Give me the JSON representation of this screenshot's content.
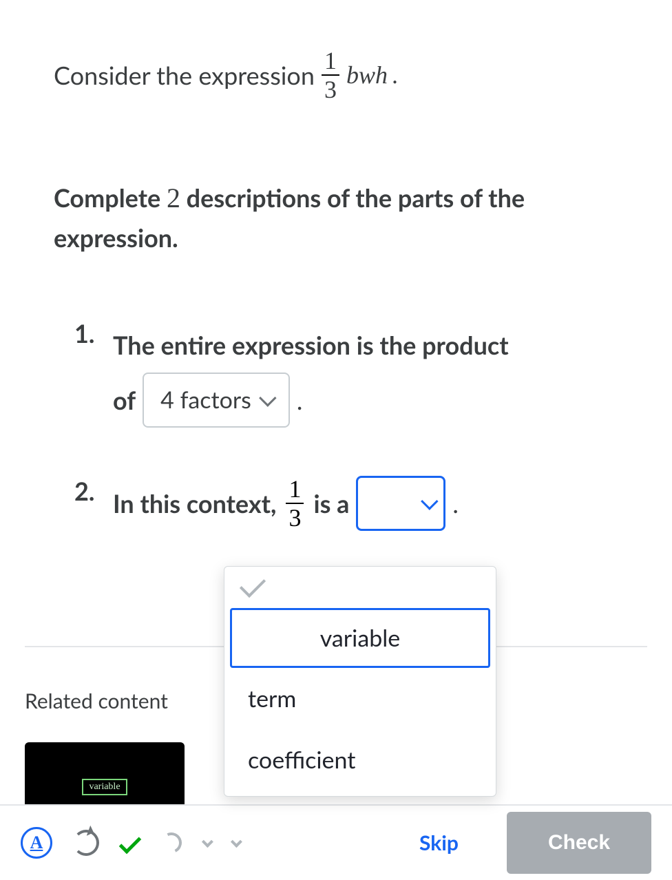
{
  "prompt": {
    "prefix": "Consider the expression",
    "frac_num": "1",
    "frac_den": "3",
    "vars": "bwh",
    "suffix": "."
  },
  "instruction": {
    "pre": "Complete ",
    "count": "2",
    "post": " descriptions of the parts of the expression."
  },
  "q1": {
    "num": "1.",
    "text_a": "The entire expression is the product",
    "text_b": "of",
    "select_value": "4 factors",
    "period": "."
  },
  "q2": {
    "num": "2.",
    "text_a": "In this context,",
    "frac_num": "1",
    "frac_den": "3",
    "text_b": "is a",
    "period": "."
  },
  "dropdown": {
    "options": [
      "variable",
      "term",
      "coefficient"
    ]
  },
  "related": {
    "heading": "Related content",
    "thumb_label": "variable"
  },
  "footer": {
    "letter": "A",
    "skip": "Skip",
    "check": "Check"
  }
}
